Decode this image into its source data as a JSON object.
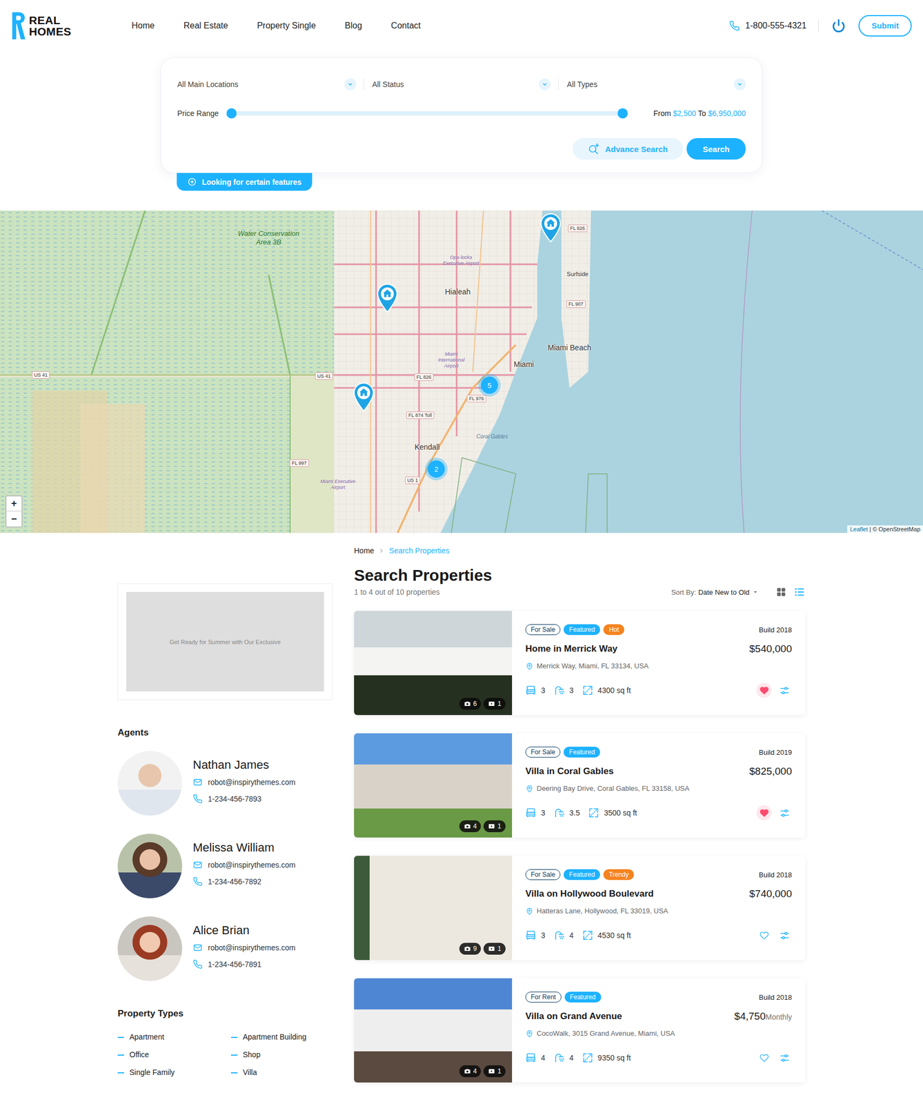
{
  "header": {
    "logo": [
      "REAL",
      "HOMES"
    ],
    "nav": [
      {
        "label": "Home",
        "selected": false
      },
      {
        "label": "Real Estate",
        "selected": false
      },
      {
        "label": "Property Single",
        "selected": false
      },
      {
        "label": "Blog",
        "selected": false
      },
      {
        "label": "Contact",
        "selected": false
      }
    ],
    "phone": "1-800-555-4321",
    "submit": "Submit"
  },
  "search": {
    "selects": [
      {
        "placeholder": "All Main Locations"
      },
      {
        "placeholder": "All Status"
      },
      {
        "placeholder": "All Types"
      }
    ],
    "price": {
      "label": "Price Range",
      "min_level": 0,
      "max_level": 1,
      "from_label": "From",
      "from": "$2,500",
      "to_label": "To",
      "to": "$6,950,000"
    },
    "advance": "Advance Search",
    "submit": "Search",
    "features": "Looking for certain features"
  },
  "map": {
    "places": [
      {
        "text": "Water Conservation Area 3B",
        "kind": "area"
      },
      {
        "text": "Hialeah",
        "kind": "city"
      },
      {
        "text": "Miami Beach",
        "kind": "city"
      },
      {
        "text": "Miami",
        "kind": "city"
      },
      {
        "text": "Kendall",
        "kind": "city"
      },
      {
        "text": "Surfside",
        "kind": "minor"
      },
      {
        "text": "Coral Gables",
        "kind": "water"
      }
    ],
    "roads": [
      {
        "text": "FL 826"
      },
      {
        "text": "FL 907"
      },
      {
        "text": "US 41"
      },
      {
        "text": "US 41"
      },
      {
        "text": "FL 826"
      },
      {
        "text": "FL 976"
      },
      {
        "text": "FL 874 Toll"
      },
      {
        "text": "US 1"
      },
      {
        "text": "FL 997"
      }
    ],
    "airports": [
      {
        "text": "Opa-locka Executive Airport"
      },
      {
        "text": "Miami International Airport"
      },
      {
        "text": "Miami Executive Airport"
      }
    ],
    "markers": [
      {
        "kind": "property"
      },
      {
        "kind": "property"
      },
      {
        "kind": "property"
      },
      {
        "kind": "cluster",
        "count": "5"
      },
      {
        "kind": "cluster",
        "count": "2"
      }
    ],
    "zoom": [
      "+",
      "−"
    ],
    "attribution": [
      "Leaflet",
      "| © OpenStreetMap"
    ]
  },
  "breadcrumb": [
    {
      "label": "Home",
      "selected": false
    },
    {
      "label": "Search Properties",
      "selected": true
    }
  ],
  "title": "Search Properties",
  "count": "1 to 4 out of 10 properties",
  "sort": {
    "label": "Sort By:",
    "value": "Date New to Old"
  },
  "views": [
    {
      "kind": "grid",
      "selected": false
    },
    {
      "kind": "list",
      "selected": true
    }
  ],
  "properties": [
    {
      "tags": [
        {
          "text": "For Sale",
          "kind": "status",
          "color": "#0b3d63"
        },
        {
          "text": "Featured",
          "kind": "filled",
          "color": "#1db2ff"
        },
        {
          "text": "Hot",
          "kind": "filled",
          "color": "#f5831f"
        }
      ],
      "build": "Build 2018",
      "title": "Home in Merrick Way",
      "price": "$540,000",
      "address": "Merrick Way, Miami, FL 33134, USA",
      "features": [
        {
          "kind": "beds",
          "value": "3"
        },
        {
          "kind": "baths",
          "value": "3"
        },
        {
          "kind": "area",
          "value": "4300 sq ft"
        }
      ],
      "photos": "6",
      "videos": "1",
      "favorited": true
    },
    {
      "tags": [
        {
          "text": "For Sale",
          "kind": "status",
          "color": "#0b3d63"
        },
        {
          "text": "Featured",
          "kind": "filled",
          "color": "#1db2ff"
        }
      ],
      "build": "Build 2019",
      "title": "Villa in Coral Gables",
      "price": "$825,000",
      "address": "Deering Bay Drive, Coral Gables, FL 33158, USA",
      "features": [
        {
          "kind": "beds",
          "value": "3"
        },
        {
          "kind": "baths",
          "value": "3.5"
        },
        {
          "kind": "area",
          "value": "3500 sq ft"
        }
      ],
      "photos": "4",
      "videos": "1",
      "favorited": true
    },
    {
      "tags": [
        {
          "text": "For Sale",
          "kind": "status",
          "color": "#0b3d63"
        },
        {
          "text": "Featured",
          "kind": "filled",
          "color": "#1db2ff"
        },
        {
          "text": "Trendy",
          "kind": "filled",
          "color": "#f5831f"
        }
      ],
      "build": "Build 2018",
      "title": "Villa on Hollywood Boulevard",
      "price": "$740,000",
      "address": "Hatteras Lane, Hollywood, FL 33019, USA",
      "features": [
        {
          "kind": "beds",
          "value": "3"
        },
        {
          "kind": "baths",
          "value": "4"
        },
        {
          "kind": "area",
          "value": "4530 sq ft"
        }
      ],
      "photos": "9",
      "videos": "1",
      "favorited": false
    },
    {
      "tags": [
        {
          "text": "For Rent",
          "kind": "status",
          "color": "#0b3d63"
        },
        {
          "text": "Featured",
          "kind": "filled",
          "color": "#1db2ff"
        }
      ],
      "build": "Build 2018",
      "title": "Villa on Grand Avenue",
      "price": "$4,750",
      "period": "Monthly",
      "address": "CocoWalk, 3015 Grand Avenue, Miami, USA",
      "features": [
        {
          "kind": "beds",
          "value": "4"
        },
        {
          "kind": "baths",
          "value": "4"
        },
        {
          "kind": "area",
          "value": "9350 sq ft"
        }
      ],
      "photos": "4",
      "videos": "1",
      "favorited": false
    }
  ],
  "sidebar": {
    "ad": "Get Ready for Summer with Our Exclusive",
    "agents_title": "Agents",
    "agents": [
      {
        "name": "Nathan James",
        "email": "robot@inspirythemes.com",
        "phone": "1-234-456-7893"
      },
      {
        "name": "Melissa William",
        "email": "robot@inspirythemes.com",
        "phone": "1-234-456-7892"
      },
      {
        "name": "Alice Brian",
        "email": "robot@inspirythemes.com",
        "phone": "1-234-456-7891"
      }
    ],
    "types_title": "Property Types",
    "types": [
      "Apartment",
      "Apartment Building",
      "Office",
      "Shop",
      "Single Family",
      "Villa"
    ]
  }
}
